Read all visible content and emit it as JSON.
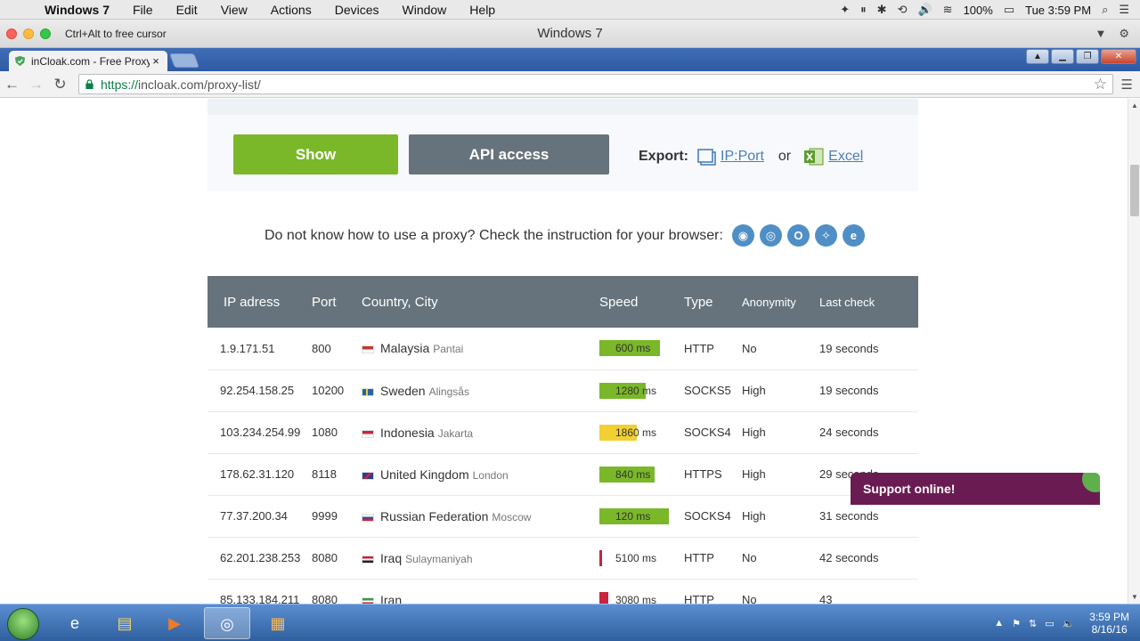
{
  "mac_menubar": {
    "app": "Windows 7",
    "items": [
      "File",
      "Edit",
      "View",
      "Actions",
      "Devices",
      "Window",
      "Help"
    ],
    "battery": "100%",
    "clock": "Tue 3:59 PM"
  },
  "vm_window": {
    "hint": "Ctrl+Alt to free cursor",
    "title": "Windows 7"
  },
  "browser": {
    "tab_title": "inCloak.com - Free Proxy",
    "tab_close": "×",
    "url_scheme": "https://",
    "url_rest": "incloak.com/proxy-list/"
  },
  "page": {
    "show_button": "Show",
    "api_button": "API access",
    "export_label": "Export:",
    "export_ipport": "IP:Port",
    "export_or": "or",
    "export_excel": "Excel",
    "help_text": "Do not know how to use a proxy? Check the instruction for your browser:",
    "table": {
      "headers": {
        "ip": "IP adress",
        "port": "Port",
        "country": "Country, City",
        "speed": "Speed",
        "type": "Type",
        "anonymity": "Anonymity",
        "last_check": "Last check"
      },
      "rows": [
        {
          "ip": "1.9.171.51",
          "port": "800",
          "country": "Malaysia",
          "city": "Pantai",
          "speed": "600 ms",
          "speed_level": 0.85,
          "speed_color": "#7ab829",
          "type": "HTTP",
          "anonymity": "No",
          "last_check": "19 seconds",
          "flag": "malaysia-flag"
        },
        {
          "ip": "92.254.158.25",
          "port": "10200",
          "country": "Sweden",
          "city": "Alingsås",
          "speed": "1280 ms",
          "speed_level": 0.65,
          "speed_color": "#7ab829",
          "type": "SOCKS5",
          "anonymity": "High",
          "last_check": "19 seconds",
          "flag": "sweden-flag"
        },
        {
          "ip": "103.234.254.99",
          "port": "1080",
          "country": "Indonesia",
          "city": "Jakarta",
          "speed": "1860 ms",
          "speed_level": 0.52,
          "speed_color": "#f2d031",
          "type": "SOCKS4",
          "anonymity": "High",
          "last_check": "24 seconds",
          "flag": "indonesia-flag"
        },
        {
          "ip": "178.62.31.120",
          "port": "8118",
          "country": "United Kingdom",
          "city": "London",
          "speed": "840 ms",
          "speed_level": 0.78,
          "speed_color": "#7ab829",
          "type": "HTTPS",
          "anonymity": "High",
          "last_check": "29 seconds",
          "flag": "uk-flag"
        },
        {
          "ip": "77.37.200.34",
          "port": "9999",
          "country": "Russian Federation",
          "city": "Moscow",
          "speed": "120 ms",
          "speed_level": 0.97,
          "speed_color": "#7ab829",
          "type": "SOCKS4",
          "anonymity": "High",
          "last_check": "31 seconds",
          "flag": "russia-flag"
        },
        {
          "ip": "62.201.238.253",
          "port": "8080",
          "country": "Iraq",
          "city": "Sulaymaniyah",
          "speed": "5100 ms",
          "speed_level": 0.04,
          "speed_color": "#c9243f",
          "type": "HTTP",
          "anonymity": "No",
          "last_check": "42 seconds",
          "flag": "iraq-flag"
        },
        {
          "ip": "85.133.184.211",
          "port": "8080",
          "country": "Iran",
          "city": "",
          "speed": "3080 ms",
          "speed_level": 0.13,
          "speed_color": "#c9243f",
          "type": "HTTP",
          "anonymity": "No",
          "last_check": "43",
          "flag": "iran-flag"
        }
      ]
    },
    "support_text": "Support online!"
  },
  "taskbar": {
    "time": "3:59 PM",
    "date": "8/16/16"
  },
  "colors": {
    "show_green": "#7ab829",
    "table_header": "#66737c",
    "link": "#4a7fb5",
    "support": "#6a1b52"
  }
}
